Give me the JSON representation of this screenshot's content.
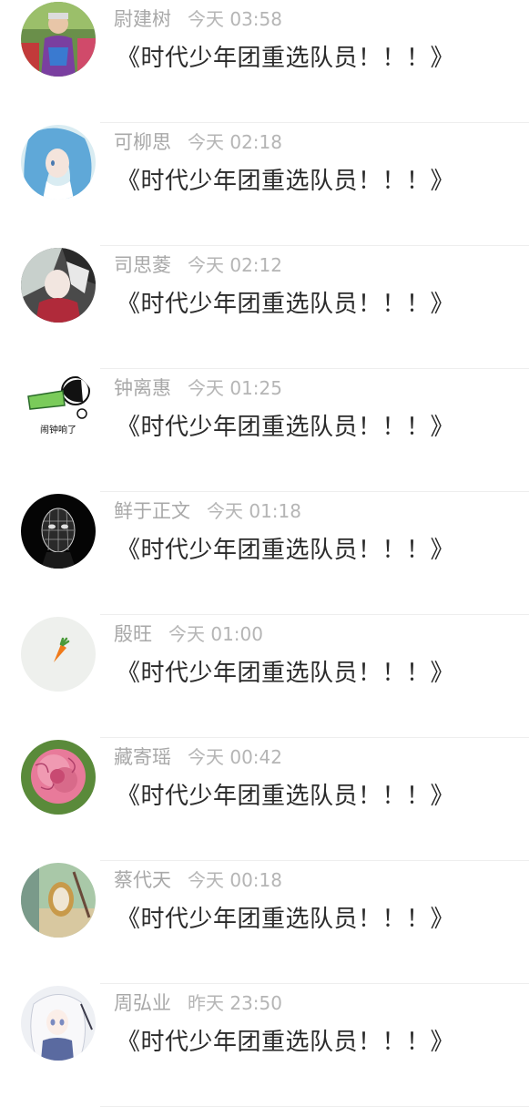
{
  "messages": [
    {
      "name": "尉建树",
      "time": "今天 03:58",
      "text": "《时代少年团重选队员！！！》",
      "avatar_icon": "person-photo-avatar"
    },
    {
      "name": "可柳思",
      "time": "今天 02:18",
      "text": "《时代少年团重选队员！！！》",
      "avatar_icon": "anime-girl-blue-hair-avatar"
    },
    {
      "name": "司思菱",
      "time": "今天 02:12",
      "text": "《时代少年团重选队员！！！》",
      "avatar_icon": "anime-white-hair-avatar"
    },
    {
      "name": "钟离惠",
      "time": "今天 01:25",
      "text": "《时代少年团重选队员！！！》",
      "avatar_icon": "alarm-meme-avatar",
      "avatar_caption": "闹钟响了"
    },
    {
      "name": "鲜于正文",
      "time": "今天 01:18",
      "text": "《时代少年团重选队员！！！》",
      "avatar_icon": "dark-mask-avatar"
    },
    {
      "name": "殷旺",
      "time": "今天 01:00",
      "text": "《时代少年团重选队员！！！》",
      "avatar_icon": "carrot-avatar"
    },
    {
      "name": "藏寄瑶",
      "time": "今天 00:42",
      "text": "《时代少年团重选队员！！！》",
      "avatar_icon": "pink-flower-avatar"
    },
    {
      "name": "蔡代天",
      "time": "今天 00:18",
      "text": "《时代少年团重选队员！！！》",
      "avatar_icon": "vintage-mirror-avatar"
    },
    {
      "name": "周弘业",
      "time": "昨天 23:50",
      "text": "《时代少年团重选队员！！！》",
      "avatar_icon": "anime-girl-white-hair-avatar"
    }
  ]
}
